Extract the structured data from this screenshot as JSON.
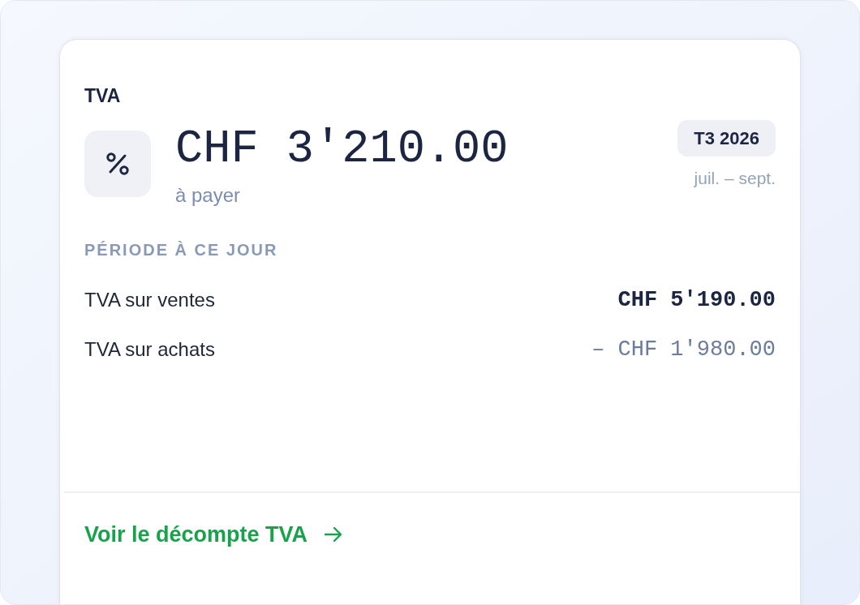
{
  "card": {
    "title": "TVA",
    "amount": "CHF 3'210.00",
    "amount_caption": "à payer",
    "period_badge": "T3 2026",
    "period_range": "juil. – sept."
  },
  "breakdown": {
    "heading": "PÉRIODE À CE JOUR",
    "rows": [
      {
        "label": "TVA sur ventes",
        "value": "CHF 5'190.00",
        "kind": "credit"
      },
      {
        "label": "TVA sur achats",
        "value": "– CHF 1'980.00",
        "kind": "deduction"
      }
    ]
  },
  "footer": {
    "link": "Voir le décompte TVA"
  }
}
